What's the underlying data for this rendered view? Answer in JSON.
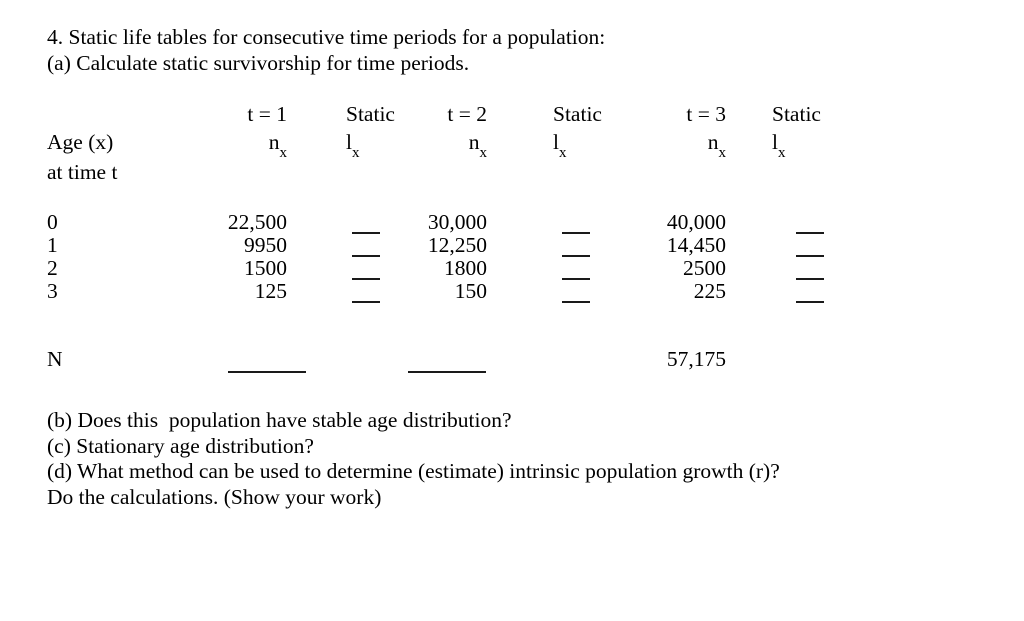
{
  "document": {
    "intro_lines": [
      "4. Static life tables for consecutive time periods for a population:",
      "(a) Calculate static survivorship for time periods."
    ],
    "outro_lines": [
      "(b) Does this  population have stable age distribution?",
      "(c) Stationary age distribution?",
      "(d) What method can be used to determine (estimate) intrinsic population growth (r)?",
      "Do the calculations. (Show your work)"
    ]
  },
  "table": {
    "row_label_header": {
      "line1": "Age (x)",
      "line2": "at time t"
    },
    "period_headers": [
      {
        "time": "t = 1",
        "static": "Static"
      },
      {
        "time": "t = 2",
        "static": "Static"
      },
      {
        "time": "t = 3",
        "static": "Static"
      }
    ],
    "symbol_headers": [
      {
        "n": "n",
        "n_sub": "x",
        "l": "l",
        "l_sub": "x"
      },
      {
        "n": "n",
        "n_sub": "x",
        "l": "l",
        "l_sub": "x"
      },
      {
        "n": "n",
        "n_sub": "x",
        "l": "l",
        "l_sub": "x"
      }
    ],
    "rows": [
      {
        "age": "0",
        "n1": "22,500",
        "l1": "",
        "n2": "30,000",
        "l2": "",
        "n3": "40,000",
        "l3": ""
      },
      {
        "age": "1",
        "n1": "9950",
        "l1": "",
        "n2": "12,250",
        "l2": "",
        "n3": "14,450",
        "l3": ""
      },
      {
        "age": "2",
        "n1": "1500",
        "l1": "",
        "n2": "1800",
        "l2": "",
        "n3": "2500",
        "l3": ""
      },
      {
        "age": "3",
        "n1": "125",
        "l1": "",
        "n2": "150",
        "l2": "",
        "n3": "225",
        "l3": ""
      }
    ],
    "total_row": {
      "age": "N",
      "n1": "",
      "n2": "",
      "n3": "57,175"
    }
  }
}
